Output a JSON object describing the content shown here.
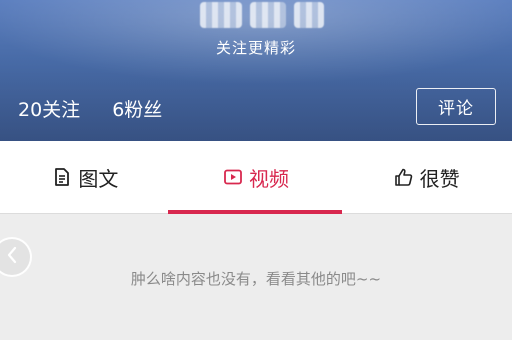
{
  "header": {
    "slogan": "关注更精彩",
    "following": "20关注",
    "followers": "6粉丝",
    "comment_button": "评论"
  },
  "tabs": [
    {
      "label": "图文",
      "icon": "document-icon",
      "active": false
    },
    {
      "label": "视频",
      "icon": "play-icon",
      "active": true
    },
    {
      "label": "很赞",
      "icon": "thumbs-up-icon",
      "active": false
    }
  ],
  "empty_state": {
    "message": "肿么啥内容也没有，看看其他的吧~~"
  },
  "colors": {
    "accent": "#d8284f",
    "header_blue": "#4d73b4",
    "background": "#ededed"
  }
}
